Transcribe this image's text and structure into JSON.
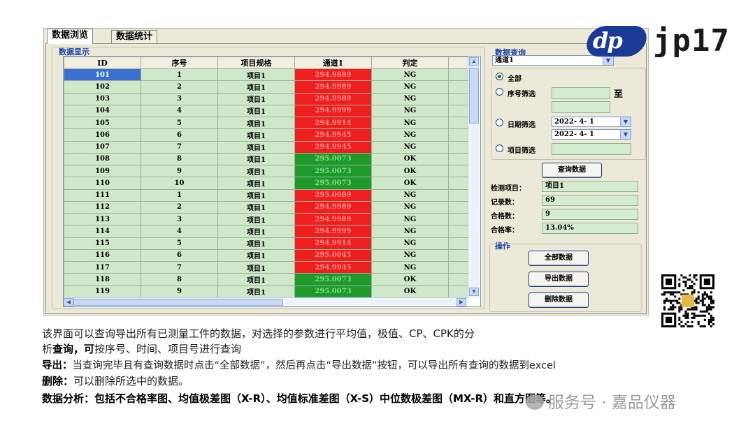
{
  "tabs": [
    "数据浏览",
    "数据统计"
  ],
  "group_titles": {
    "data_display": "数据显示",
    "data_query": "数据查询",
    "operations": "操作"
  },
  "grid": {
    "columns": [
      "ID",
      "序号",
      "项目规格",
      "通道1",
      "判定"
    ],
    "rows": [
      {
        "id": "101",
        "seq": "1",
        "spec": "项目1",
        "ch1": "294.9889",
        "result": "NG"
      },
      {
        "id": "102",
        "seq": "2",
        "spec": "项目1",
        "ch1": "294.9989",
        "result": "NG"
      },
      {
        "id": "103",
        "seq": "3",
        "spec": "项目1",
        "ch1": "294.9989",
        "result": "NG"
      },
      {
        "id": "104",
        "seq": "4",
        "spec": "项目1",
        "ch1": "294.9999",
        "result": "NG"
      },
      {
        "id": "105",
        "seq": "5",
        "spec": "项目1",
        "ch1": "294.9914",
        "result": "NG"
      },
      {
        "id": "106",
        "seq": "6",
        "spec": "项目1",
        "ch1": "294.9945",
        "result": "NG"
      },
      {
        "id": "107",
        "seq": "7",
        "spec": "项目1",
        "ch1": "294.9945",
        "result": "NG"
      },
      {
        "id": "108",
        "seq": "8",
        "spec": "项目1",
        "ch1": "295.0073",
        "result": "OK"
      },
      {
        "id": "109",
        "seq": "9",
        "spec": "项目1",
        "ch1": "295.0073",
        "result": "OK"
      },
      {
        "id": "110",
        "seq": "10",
        "spec": "项目1",
        "ch1": "295.0073",
        "result": "OK"
      },
      {
        "id": "111",
        "seq": "1",
        "spec": "项目1",
        "ch1": "295.0089",
        "result": "NG"
      },
      {
        "id": "112",
        "seq": "2",
        "spec": "项目1",
        "ch1": "294.9989",
        "result": "NG"
      },
      {
        "id": "113",
        "seq": "3",
        "spec": "项目1",
        "ch1": "294.9989",
        "result": "NG"
      },
      {
        "id": "114",
        "seq": "4",
        "spec": "项目1",
        "ch1": "294.9999",
        "result": "NG"
      },
      {
        "id": "115",
        "seq": "5",
        "spec": "项目1",
        "ch1": "294.9914",
        "result": "NG"
      },
      {
        "id": "116",
        "seq": "6",
        "spec": "项目1",
        "ch1": "295.0045",
        "result": "NG"
      },
      {
        "id": "117",
        "seq": "7",
        "spec": "项目1",
        "ch1": "294.9945",
        "result": "NG"
      },
      {
        "id": "118",
        "seq": "8",
        "spec": "项目1",
        "ch1": "295.0073",
        "result": "OK"
      },
      {
        "id": "119",
        "seq": "9",
        "spec": "项目1",
        "ch1": "295.0073",
        "result": "OK"
      }
    ]
  },
  "query": {
    "channel_select": "通道1",
    "radio_all": "全部",
    "radio_seq": "序号筛选",
    "to_label": "至",
    "radio_date": "日期筛选",
    "date_from": "2022- 4- 1",
    "date_to": "2022- 4- 1",
    "radio_project": "项目筛选",
    "query_button": "查询数据"
  },
  "stats": {
    "item_label": "检测项目：",
    "item_value": "项目1",
    "records_label": "记录数：",
    "records_value": "69",
    "pass_label": "合格数：",
    "pass_value": "9",
    "rate_label": "合格率：",
    "rate_value": "13.04%"
  },
  "ops": {
    "all_data": "全部数据",
    "export_data": "导出数据",
    "delete_data": "删除数据"
  },
  "logo": {
    "mark": "dp",
    "text": "jp17"
  },
  "captions": {
    "line1": "该界面可以查询导出所有已测量工件的数据，对选择的参数进行平均值，极值、CP、CPK的分",
    "line2_prefix": "析",
    "line2_bold": "查询，可",
    "line2_rest": "按序号、时间、项目号进行查询",
    "line3_bold": "导出：",
    "line3_rest": "当查询完毕且有查询数据时点击“全部数据”，然后再点击“导出数据”按钮，可以导出所有查询的数据到excel",
    "line4_bold": "删除：",
    "line4_rest": "可以删除所选中的数据。",
    "line5": "数据分析：包括不合格率图、均值极差图（X-R）、均值标准差图（X-S）中位数极差图（MX-R）和直方图等。"
  },
  "watermark": "服务号 · 嘉品仪器",
  "colors": {
    "ng": "#ee1f1f",
    "ok": "#1f9a2a",
    "cell": "#cfe8c9",
    "selected": "#3a70cf",
    "accent": "#1b3ea8"
  }
}
